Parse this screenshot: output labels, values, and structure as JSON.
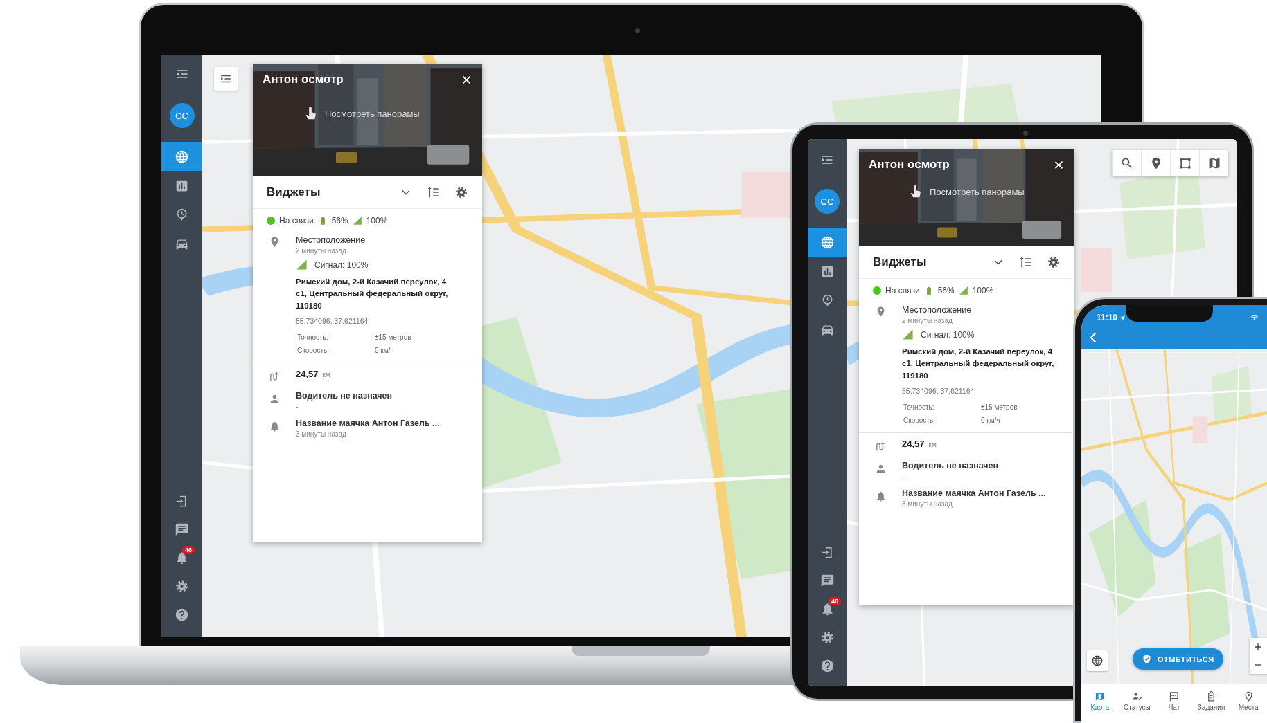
{
  "laptop": {
    "sidebar": {
      "avatar": "CC",
      "items": [
        {
          "kind": "map",
          "selected": true
        },
        {
          "kind": "reports",
          "selected": false
        },
        {
          "kind": "history",
          "selected": false
        },
        {
          "kind": "vehicles",
          "selected": false
        }
      ],
      "bottom_items": [
        {
          "kind": "logout"
        },
        {
          "kind": "chat"
        },
        {
          "kind": "notifications",
          "badge": "46"
        },
        {
          "kind": "settings"
        },
        {
          "kind": "help"
        }
      ]
    },
    "layer_toggle": true,
    "panel": {
      "title": "Антон осмотр",
      "panorama_link": "Посмотреть панорамы",
      "widgets_title": "Виджеты",
      "status": {
        "online": true,
        "label": "На связи",
        "battery": "56%",
        "signal": "100%"
      },
      "location": {
        "title": "Местоположение",
        "time": "2 минуты назад",
        "signal": "Сигнал: 100%",
        "address": "Римский дом, 2-й Казачий переулок, 4 с1, Центральный федеральный округ, 119180",
        "coords": "55.734096, 37.621164",
        "details": [
          {
            "label": "Точность:",
            "value": "±15 метров"
          },
          {
            "label": "Скорость:",
            "value": "0 км/ч"
          }
        ]
      },
      "mileage": {
        "value": "24,57",
        "unit": "км"
      },
      "driver": {
        "name": "Водитель не назначен",
        "note": "-"
      },
      "beacon": {
        "name": "Название маячка Антон Газель ...",
        "time": "3 минуты назад"
      }
    }
  },
  "tablet": {
    "sidebar": {
      "avatar": "CC",
      "items": [
        {
          "kind": "map",
          "selected": true
        },
        {
          "kind": "reports",
          "selected": false
        },
        {
          "kind": "history",
          "selected": false
        },
        {
          "kind": "vehicles",
          "selected": false
        }
      ],
      "bottom_items": [
        {
          "kind": "logout"
        },
        {
          "kind": "chat"
        },
        {
          "kind": "notifications",
          "badge": "46"
        },
        {
          "kind": "settings"
        },
        {
          "kind": "help"
        }
      ]
    },
    "map_toolbar": [
      {
        "kind": "search"
      },
      {
        "kind": "marker"
      },
      {
        "kind": "area"
      },
      {
        "kind": "layers"
      }
    ],
    "panel": {
      "title": "Антон осмотр",
      "panorama_link": "Посмотреть панорамы",
      "widgets_title": "Виджеты",
      "status": {
        "online": true,
        "label": "На связи",
        "battery": "56%",
        "signal": "100%"
      },
      "location": {
        "title": "Местоположение",
        "time": "2 минуты назад",
        "signal": "Сигнал: 100%",
        "address": "Римский дом, 2-й Казачий переулок, 4 с1, Центральный федеральный округ, 119180",
        "coords": "55.734096, 37.621164",
        "details": [
          {
            "label": "Точность:",
            "value": "±15 метров"
          },
          {
            "label": "Скорость:",
            "value": "0 км/ч"
          }
        ]
      },
      "mileage": {
        "value": "24,57",
        "unit": "км"
      },
      "driver": {
        "name": "Водитель не назначен",
        "note": "-"
      },
      "beacon": {
        "name": "Название маячка Антон Газель ...",
        "time": "3 минуты назад"
      }
    }
  },
  "phone": {
    "status_bar": {
      "time": "11:10"
    },
    "check_in_button": "ОТМЕТИТЬСЯ",
    "tabs": [
      {
        "kind": "map",
        "label": "Карта",
        "selected": true
      },
      {
        "kind": "statuses",
        "label": "Статусы",
        "selected": false
      },
      {
        "kind": "chat",
        "label": "Чат",
        "selected": false
      },
      {
        "kind": "tasks",
        "label": "Задания",
        "selected": false
      },
      {
        "kind": "places",
        "label": "Места",
        "selected": false
      }
    ]
  }
}
